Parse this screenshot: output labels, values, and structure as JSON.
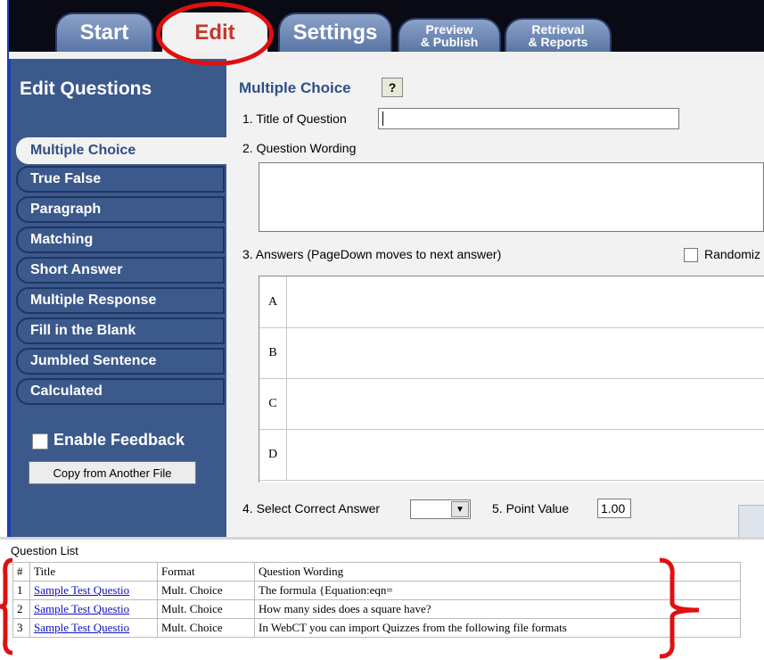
{
  "tabs": [
    {
      "label": "Start"
    },
    {
      "label": "Edit"
    },
    {
      "label": "Settings"
    },
    {
      "label": "Preview\n& Publish"
    },
    {
      "label": "Retrieval\n& Reports"
    }
  ],
  "sidebar": {
    "heading": "Edit Questions",
    "items": [
      {
        "label": "Multiple Choice"
      },
      {
        "label": "True False"
      },
      {
        "label": "Paragraph"
      },
      {
        "label": "Matching"
      },
      {
        "label": "Short Answer"
      },
      {
        "label": "Multiple Response"
      },
      {
        "label": "Fill in the Blank"
      },
      {
        "label": "Jumbled Sentence"
      },
      {
        "label": "Calculated"
      }
    ],
    "feedback_label": "Enable Feedback",
    "copy_button": "Copy from Another File"
  },
  "editor": {
    "type_title": "Multiple Choice",
    "help_label": "?",
    "title_label": "1.  Title of Question",
    "title_value": "",
    "wording_label": "2.  Question Wording",
    "answers_label": "3.  Answers  (PageDown moves to next answer)",
    "randomize_label": "Randomiz",
    "answer_letters": [
      "A",
      "B",
      "C",
      "D"
    ],
    "select_correct_label": "4.  Select Correct Answer",
    "point_value_label": "5.  Point Value",
    "point_value": "1.00"
  },
  "question_list": {
    "label": "Question List",
    "headers": [
      "#",
      "Title",
      "Format",
      "Question Wording"
    ],
    "rows": [
      {
        "num": "1",
        "title": "Sample Test Questio",
        "format": "Mult. Choice",
        "wording": "The formula {Equation:eqn="
      },
      {
        "num": "2",
        "title": "Sample Test Questio",
        "format": "Mult. Choice",
        "wording": "How many sides does a square have?"
      },
      {
        "num": "3",
        "title": "Sample Test Questio",
        "format": "Mult. Choice",
        "wording": "In WebCT you can import Quizzes from the following file formats"
      }
    ]
  },
  "colors": {
    "panel": "#3c598c",
    "accent": "#2f4f86",
    "annotation": "#e01010"
  }
}
